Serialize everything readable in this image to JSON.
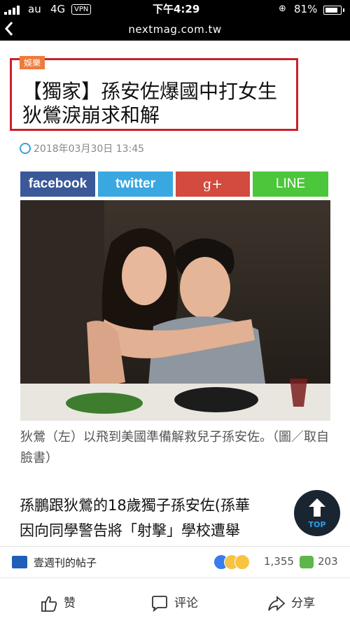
{
  "status_bar": {
    "carrier": "au",
    "network": "4G",
    "vpn": "VPN",
    "time": "下午4:29",
    "battery": "81%"
  },
  "browser": {
    "url": "nextmag.com.tw"
  },
  "article": {
    "category": "娛樂",
    "title": "【獨家】孫安佐爆國中打女生　狄鶯淚崩求和解",
    "date": "2018年03月30日 13:45",
    "share_buttons": [
      "facebook",
      "twitter",
      "g+",
      "LINE"
    ],
    "caption": "狄鶯（左）以飛到美國準備解救兒子孫安佐。（圖／取自臉書）",
    "body_lines": [
      "孫鵬跟狄鶯的18歲獨子孫安佐(孫華",
      "因向同學警告將「射擊」學校遭舉"
    ],
    "top_button": "TOP"
  },
  "facebook_bar": {
    "page_name": "壹週刊的帖子",
    "reaction_count": "1,355",
    "comment_count": "203",
    "like_label": "赞",
    "comment_label": "评论",
    "share_label": "分享"
  },
  "colors": {
    "title_border": "#c8222a",
    "category_tag": "#ee7a3a",
    "facebook": "#3b5998",
    "twitter": "#3aa8e0",
    "google_plus": "#d24b3e",
    "line": "#4cc63a"
  }
}
